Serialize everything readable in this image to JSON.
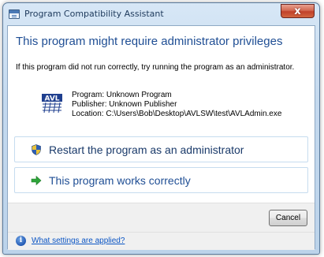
{
  "window": {
    "title": "Program Compatibility Assistant",
    "close_label": "x"
  },
  "main": {
    "heading": "This program might require administrator privileges",
    "description": "If this program did not run correctly, try running the program as an administrator.",
    "program": {
      "name_line": "Program: Unknown Program",
      "publisher_line": "Publisher: Unknown Publisher",
      "location_line": "Location: C:\\Users\\Bob\\Desktop\\AVLSW\\test\\AVLAdmin.exe",
      "logo_text": "AVL"
    }
  },
  "commands": [
    {
      "label": "Restart the program as an administrator",
      "icon": "shield-icon"
    },
    {
      "label": "This program works correctly",
      "icon": "green-arrow-icon"
    }
  ],
  "footer": {
    "cancel_label": "Cancel",
    "link_label": "What settings are applied?",
    "info_icon_glyph": "i"
  },
  "colors": {
    "heading": "#1f4e94",
    "link": "#0b55c4",
    "close_button": "#c1412a",
    "arrow": "#2ea43a"
  }
}
